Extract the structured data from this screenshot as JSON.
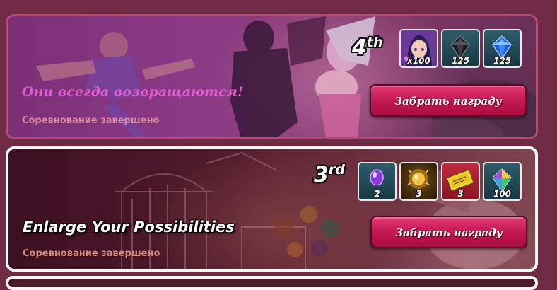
{
  "contests": [
    {
      "rank_number": "4",
      "rank_suffix": "th",
      "title": "Они всегда возвращаются!",
      "status": "Соревнование завершено",
      "claim_label": "Забрать награду",
      "rewards": [
        {
          "icon": "girl-card-icon",
          "qty": "x100"
        },
        {
          "icon": "dark-gem-icon",
          "qty": "125"
        },
        {
          "icon": "blue-gem-icon",
          "qty": "125"
        }
      ]
    },
    {
      "rank_number": "3",
      "rank_suffix": "rd",
      "title": "Enlarge Your Possibilities",
      "status": "Соревнование завершено",
      "claim_label": "Забрать награду",
      "rewards": [
        {
          "icon": "purple-orb-icon",
          "qty": "2"
        },
        {
          "icon": "golden-orb-icon",
          "qty": "3"
        },
        {
          "icon": "ticket-icon",
          "qty": "3"
        },
        {
          "icon": "rainbow-gem-icon",
          "qty": "100"
        }
      ]
    }
  ],
  "colors": {
    "claim_button": "#c2154f",
    "card1_title": "#e35bd4",
    "status_text": "#d98a9e",
    "card_border_active": "#f5f5f5"
  }
}
